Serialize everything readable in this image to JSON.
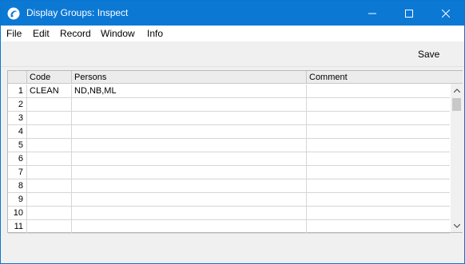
{
  "window": {
    "title": "Display Groups: Inspect"
  },
  "menu": {
    "items": [
      "File",
      "Edit",
      "Record",
      "Window",
      "Info"
    ]
  },
  "toolbar": {
    "save_label": "Save"
  },
  "matrix": {
    "columns": [
      "Code",
      "Persons",
      "Comment"
    ],
    "rows": [
      {
        "num": "1",
        "code": "CLEAN",
        "persons": "ND,NB,ML",
        "comment": ""
      },
      {
        "num": "2",
        "code": "",
        "persons": "",
        "comment": ""
      },
      {
        "num": "3",
        "code": "",
        "persons": "",
        "comment": ""
      },
      {
        "num": "4",
        "code": "",
        "persons": "",
        "comment": ""
      },
      {
        "num": "5",
        "code": "",
        "persons": "",
        "comment": ""
      },
      {
        "num": "6",
        "code": "",
        "persons": "",
        "comment": ""
      },
      {
        "num": "7",
        "code": "",
        "persons": "",
        "comment": ""
      },
      {
        "num": "8",
        "code": "",
        "persons": "",
        "comment": ""
      },
      {
        "num": "9",
        "code": "",
        "persons": "",
        "comment": ""
      },
      {
        "num": "10",
        "code": "",
        "persons": "",
        "comment": ""
      },
      {
        "num": "11",
        "code": "",
        "persons": "",
        "comment": ""
      }
    ]
  },
  "colors": {
    "titlebar": "#0b78d4",
    "background": "#f0f0f0"
  }
}
